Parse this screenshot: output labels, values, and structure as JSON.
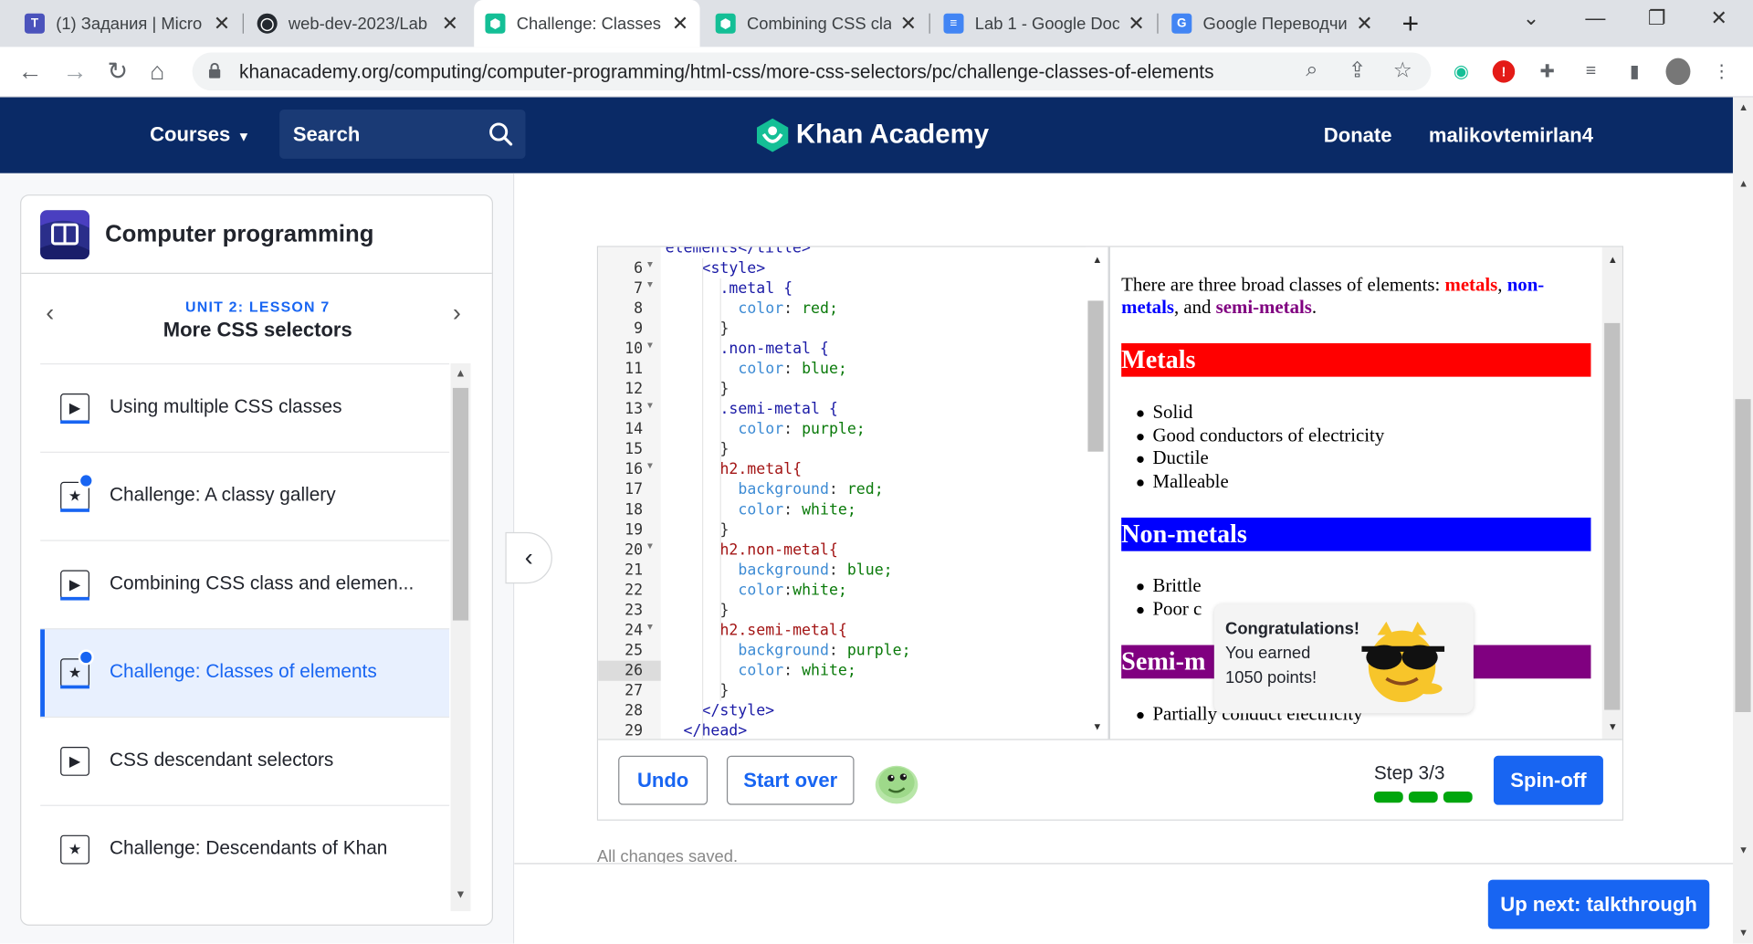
{
  "browser": {
    "tabs": [
      {
        "title": "(1) Задания | Micro",
        "icon_color": "#4b53bc",
        "icon_letter": "T"
      },
      {
        "title": "web-dev-2023/Lab",
        "icon_color": "#24292f",
        "icon_letter": "◯"
      },
      {
        "title": "Challenge: Classes",
        "icon_color": "#14bf96",
        "icon_letter": "⬢"
      },
      {
        "title": "Combining CSS cla",
        "icon_color": "#14bf96",
        "icon_letter": "⬢"
      },
      {
        "title": "Lab 1 - Google Doc",
        "icon_color": "#4285f4",
        "icon_letter": "≡"
      },
      {
        "title": "Google Переводчи",
        "icon_color": "#4285f4",
        "icon_letter": "G"
      }
    ],
    "url": "khanacademy.org/computing/computer-programming/html-css/more-css-selectors/pc/challenge-classes-of-elements"
  },
  "header": {
    "courses": "Courses",
    "search": "Search",
    "logo": "Khan Academy",
    "donate": "Donate",
    "username": "malikovtemirlan4"
  },
  "sidebar": {
    "course_title": "Computer programming",
    "unit_label": "UNIT 2: LESSON 7",
    "lesson_title": "More CSS selectors",
    "items": [
      {
        "label": "Using multiple CSS classes",
        "kind": "video",
        "done": false
      },
      {
        "label": "Challenge: A classy gallery",
        "kind": "challenge",
        "done": true
      },
      {
        "label": "Combining CSS class and elemen...",
        "kind": "video",
        "done": false
      },
      {
        "label": "Challenge: Classes of elements",
        "kind": "challenge",
        "done": true
      },
      {
        "label": "CSS descendant selectors",
        "kind": "video",
        "done": false
      },
      {
        "label": "Challenge: Descendants of Khan",
        "kind": "challenge",
        "done": false
      }
    ]
  },
  "editor": {
    "partial_first_line": "elements</title>",
    "lines": [
      {
        "n": "6",
        "fold": true,
        "text": "<style>"
      },
      {
        "n": "7",
        "fold": true,
        "text": ".metal {"
      },
      {
        "n": "8",
        "fold": false,
        "text": "color: red;"
      },
      {
        "n": "9",
        "fold": false,
        "text": "}"
      },
      {
        "n": "10",
        "fold": true,
        "text": ".non-metal {"
      },
      {
        "n": "11",
        "fold": false,
        "text": "color: blue;"
      },
      {
        "n": "12",
        "fold": false,
        "text": "}"
      },
      {
        "n": "13",
        "fold": true,
        "text": ".semi-metal {"
      },
      {
        "n": "14",
        "fold": false,
        "text": "color: purple;"
      },
      {
        "n": "15",
        "fold": false,
        "text": "}"
      },
      {
        "n": "16",
        "fold": true,
        "text": "h2.metal{"
      },
      {
        "n": "17",
        "fold": false,
        "text": "background: red;"
      },
      {
        "n": "18",
        "fold": false,
        "text": "color: white;"
      },
      {
        "n": "19",
        "fold": false,
        "text": "}"
      },
      {
        "n": "20",
        "fold": true,
        "text": "h2.non-metal{"
      },
      {
        "n": "21",
        "fold": false,
        "text": "background: blue;"
      },
      {
        "n": "22",
        "fold": false,
        "text": "color:white;"
      },
      {
        "n": "23",
        "fold": false,
        "text": "}"
      },
      {
        "n": "24",
        "fold": true,
        "text": "h2.semi-metal{"
      },
      {
        "n": "25",
        "fold": false,
        "text": "background: purple;"
      },
      {
        "n": "26",
        "fold": false,
        "text": "color: white;"
      },
      {
        "n": "27",
        "fold": false,
        "text": "}"
      },
      {
        "n": "28",
        "fold": false,
        "text": "</style>"
      },
      {
        "n": "29",
        "fold": false,
        "text": "</head>"
      }
    ],
    "current_line": "26"
  },
  "preview": {
    "intro_prefix": "There are three broad classes of elements: ",
    "metals_word": "metals",
    "sep1": ", ",
    "nonmetals_word": "non-metals",
    "sep2": ", and ",
    "semimetals_word": "semi-metals",
    "end": ".",
    "metals_heading": "Metals",
    "metals_list": [
      "Solid",
      "Good conductors of electricity",
      "Ductile",
      "Malleable"
    ],
    "nonmetals_heading": "Non-metals",
    "nonmetals_list": [
      "Brittle",
      "Poor c"
    ],
    "semimetals_heading": "Semi-m",
    "semimetals_list": [
      "Partially conduct electricity"
    ]
  },
  "toast": {
    "title": "Congratulations!",
    "line1": "You earned",
    "line2": "1050 points!"
  },
  "toolbar": {
    "undo": "Undo",
    "start_over": "Start over",
    "step": "Step 3/3",
    "steps_total": 3,
    "steps_done": 3,
    "spin_off": "Spin-off"
  },
  "status": {
    "saved": "All changes saved."
  },
  "footer": {
    "up_next": "Up next: talkthrough"
  },
  "colors": {
    "brand_navy": "#0a2a66",
    "accent_blue": "#1865f2",
    "progress_green": "#00a60e"
  }
}
